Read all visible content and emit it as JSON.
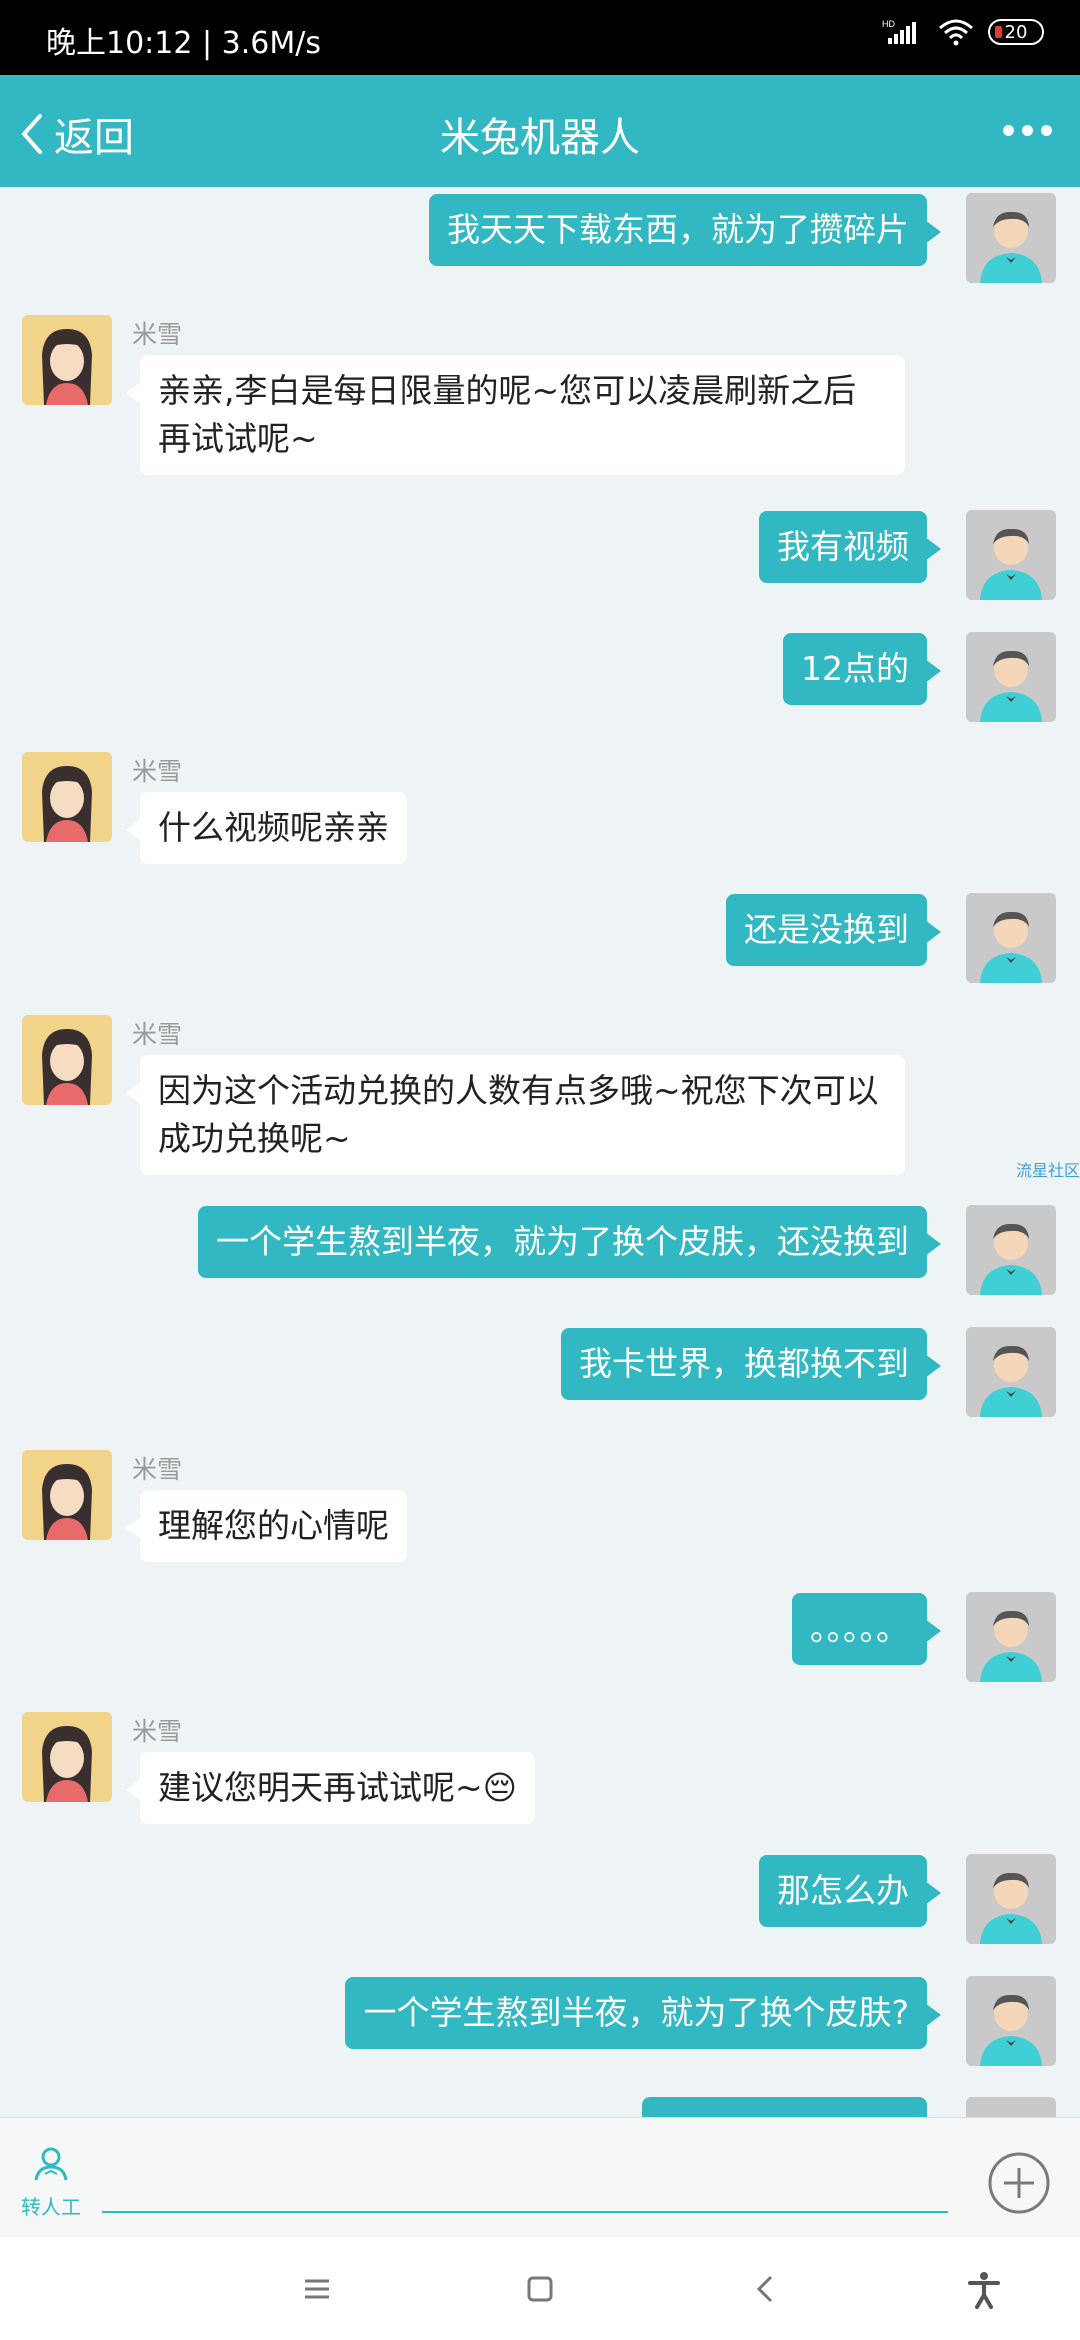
{
  "status_bar": {
    "time_speed": "晚上10:12 | 3.6M/s",
    "network": "HD",
    "battery": "20"
  },
  "header": {
    "back_label": "返回",
    "title": "米兔机器人"
  },
  "bot_name": "米雪",
  "messages": [
    {
      "from": "user",
      "text": "我天天下载东西，就为了攒碎片"
    },
    {
      "from": "bot",
      "text": "亲亲,李白是每日限量的呢~您可以凌晨刷新之后再试试呢~"
    },
    {
      "from": "user",
      "text": "我有视频"
    },
    {
      "from": "user",
      "text": "12点的"
    },
    {
      "from": "bot",
      "text": "什么视频呢亲亲"
    },
    {
      "from": "user",
      "text": "还是没换到"
    },
    {
      "from": "bot",
      "text": "因为这个活动兑换的人数有点多哦~祝您下次可以成功兑换呢~"
    },
    {
      "from": "user",
      "text": "一个学生熬到半夜，就为了换个皮肤，还没换到"
    },
    {
      "from": "user",
      "text": "我卡世界，换都换不到"
    },
    {
      "from": "bot",
      "text": "理解您的心情呢"
    },
    {
      "from": "user",
      "text": "。。。。。"
    },
    {
      "from": "bot",
      "text": "建议您明天再试试呢~😔"
    },
    {
      "from": "user",
      "text": "那怎么办"
    },
    {
      "from": "user",
      "text": "一个学生熬到半夜，就为了换个皮肤?"
    }
  ],
  "watermark": "流星社区",
  "input_bar": {
    "human_label": "转人工"
  },
  "colors": {
    "accent": "#31b8c3",
    "background": "#eef4f5"
  }
}
